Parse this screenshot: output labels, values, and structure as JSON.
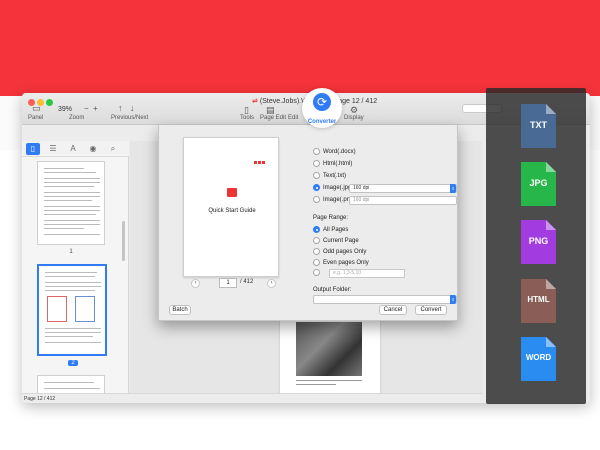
{
  "window": {
    "title": "(Steve.Jobs).Walter.I... mage 12 / 412",
    "toolbar": {
      "panel": "Panel",
      "zoom_value": "39%",
      "zoom_label": "Zoom",
      "prevnext_label": "Previous/Next",
      "tools_label": "Tools",
      "page_edit_label": "Page Edit",
      "edit_label": "Edit",
      "display_label": "Display"
    },
    "status": "Page 12 / 412"
  },
  "sidebar": {
    "thumbnails": [
      {
        "page": "1",
        "selected": false
      },
      {
        "page": "2",
        "selected": true
      }
    ]
  },
  "converter": {
    "label": "Converter"
  },
  "dialog": {
    "preview": {
      "title": "Quick Start Guide",
      "page_current": "1",
      "page_total": "/ 412"
    },
    "formats": [
      {
        "label": "Word(.docx)",
        "selected": false
      },
      {
        "label": "Html(.html)",
        "selected": false
      },
      {
        "label": "Text(.txt)",
        "selected": false
      },
      {
        "label": "Image(.jpg)",
        "selected": true
      },
      {
        "label": "Image(.png)",
        "selected": false
      }
    ],
    "jpg_dpi": "160 dpi",
    "png_dpi": "160 dpi",
    "page_range_label": "Page Range:",
    "ranges": [
      {
        "label": "All Pages",
        "selected": true
      },
      {
        "label": "Current Page",
        "selected": false
      },
      {
        "label": "Odd pages Only",
        "selected": false
      },
      {
        "label": "Even pages Only",
        "selected": false
      }
    ],
    "custom_range_placeholder": "e.g. 1,3-5,10",
    "output_folder_label": "Output Folder:",
    "batch_button": "Batch",
    "cancel_button": "Cancel",
    "convert_button": "Convert"
  },
  "format_panel": {
    "items": [
      {
        "label": "TXT",
        "color": "#4a6a96"
      },
      {
        "label": "JPG",
        "color": "#27b64a"
      },
      {
        "label": "PNG",
        "color": "#a23ce0"
      },
      {
        "label": "HTML",
        "color": "#8a5e56"
      },
      {
        "label": "WORD",
        "color": "#2a8cf0"
      }
    ]
  }
}
